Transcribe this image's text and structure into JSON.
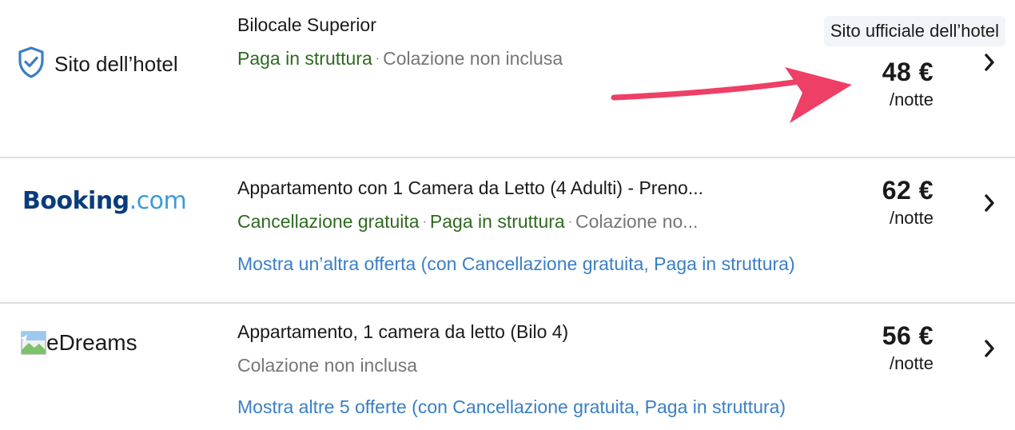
{
  "colors": {
    "green": "#2d6a1f",
    "grey": "#767676",
    "link": "#3a7fc4",
    "arrow": "#ee3f66",
    "shield": "#3a7fc4",
    "booking_dark": "#0a3c7a",
    "booking_light": "#3b9ad9"
  },
  "official_label": "Sito ufficiale dell’hotel",
  "rows": [
    {
      "provider": {
        "name": "Sito dell’hotel",
        "icon": "shield-check-icon"
      },
      "title": "Bilocale Superior",
      "tags": [
        {
          "text": "Paga in struttura",
          "color": "green"
        },
        {
          "text": "Colazione non inclusa",
          "color": "grey"
        }
      ],
      "price": "48 €",
      "per_night": "/notte"
    },
    {
      "provider": {
        "name_part1": "Booking",
        "name_part2": ".com"
      },
      "title": "Appartamento con 1 Camera da Letto (4 Adulti) - Preno...",
      "tags": [
        {
          "text": "Cancellazione gratuita",
          "color": "green"
        },
        {
          "text": "Paga in struttura",
          "color": "green"
        },
        {
          "text": "Colazione no...",
          "color": "grey"
        }
      ],
      "more_link": "Mostra un’altra offerta (con Cancellazione gratuita, Paga in struttura)",
      "price": "62 €",
      "per_night": "/notte"
    },
    {
      "provider": {
        "name": "eDreams",
        "icon": "broken-image-icon"
      },
      "title": "Appartamento, 1 camera da letto (Bilo 4)",
      "tags": [
        {
          "text": "Colazione non inclusa",
          "color": "grey"
        }
      ],
      "more_link": "Mostra altre 5 offerte (con Cancellazione gratuita, Paga in struttura)",
      "price": "56 €",
      "per_night": "/notte"
    }
  ]
}
